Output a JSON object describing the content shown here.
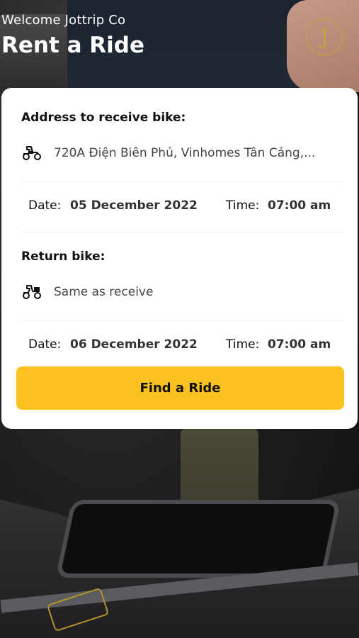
{
  "header": {
    "welcome": "Welcome Jottrip Co",
    "title": "Rent a Ride",
    "logo_letter": "J"
  },
  "receive": {
    "section_label": "Address to receive bike:",
    "address": "720A Điện Biên Phủ, Vinhomes Tân Cảng,...",
    "icon": "scooter-icon",
    "date_label": "Date:",
    "date_value": "05 December 2022",
    "time_label": "Time:",
    "time_value": "07:00 am"
  },
  "return": {
    "section_label": "Return bike:",
    "address": "Same as receive",
    "icon": "scooter-return-icon",
    "date_label": "Date:",
    "date_value": "06 December 2022",
    "time_label": "Time:",
    "time_value": "07:00 am"
  },
  "actions": {
    "find_label": "Find a Ride"
  },
  "colors": {
    "accent": "#fbc21f",
    "logo_gold": "#c9a23a"
  }
}
